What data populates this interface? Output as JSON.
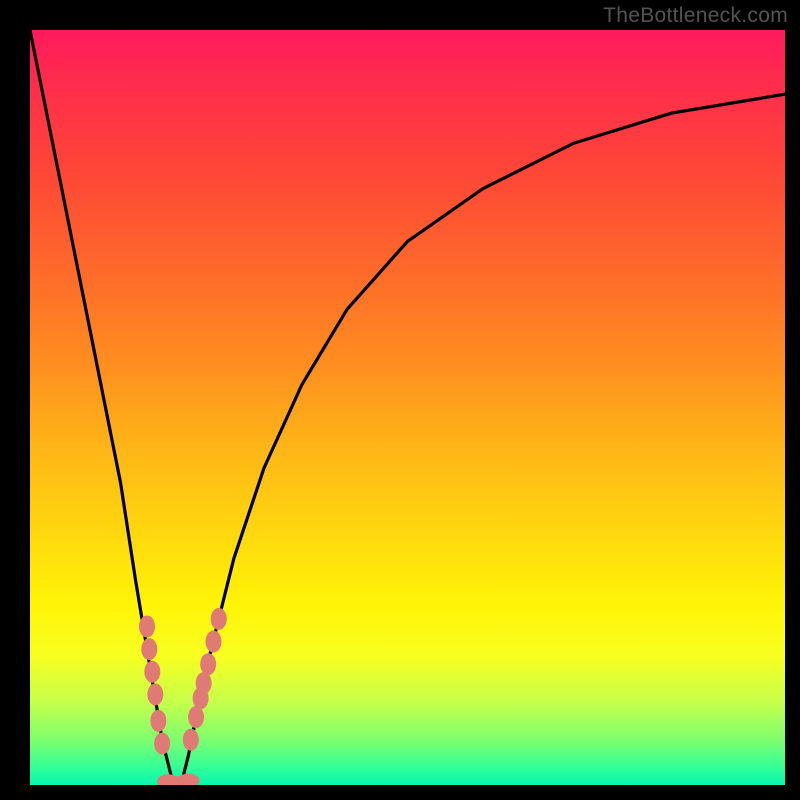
{
  "watermark": {
    "text": "TheBottleneck.com"
  },
  "colors": {
    "frame": "#000000",
    "curve_stroke": "#000000",
    "marker_fill": "#e07a74",
    "marker_stroke": "#c9635d",
    "gradient_stops": [
      "#ff1a5e",
      "#ff4438",
      "#ff8d20",
      "#ffd60e",
      "#fff407",
      "#c6ff4a",
      "#2bff9b"
    ]
  },
  "chart_data": {
    "type": "line",
    "title": "",
    "xlabel": "",
    "ylabel": "",
    "xlim": [
      0,
      100
    ],
    "ylim": [
      0,
      100
    ],
    "grid": false,
    "x": [
      0,
      3,
      6,
      9,
      12,
      14,
      16,
      17.5,
      19,
      20,
      21,
      22,
      24,
      27,
      31,
      36,
      42,
      50,
      60,
      72,
      85,
      100
    ],
    "values": [
      100,
      85,
      70,
      55,
      40,
      27,
      15,
      6,
      0,
      0,
      4,
      9,
      18,
      30,
      42,
      53,
      63,
      72,
      79,
      85,
      89,
      91.5
    ],
    "notch": {
      "x": 19.5,
      "y": 0
    },
    "markers_left_branch": [
      {
        "x": 15.5,
        "y": 21
      },
      {
        "x": 15.8,
        "y": 18
      },
      {
        "x": 16.2,
        "y": 15
      },
      {
        "x": 16.6,
        "y": 12
      },
      {
        "x": 17.0,
        "y": 8.5
      },
      {
        "x": 17.5,
        "y": 5.5
      }
    ],
    "markers_right_branch": [
      {
        "x": 21.3,
        "y": 6
      },
      {
        "x": 22.0,
        "y": 9
      },
      {
        "x": 22.6,
        "y": 11.5
      },
      {
        "x": 23.0,
        "y": 13.5
      },
      {
        "x": 23.6,
        "y": 16
      },
      {
        "x": 24.3,
        "y": 19
      },
      {
        "x": 25.0,
        "y": 22
      }
    ],
    "markers_bottom": [
      {
        "x": 18.3,
        "y": 0.5
      },
      {
        "x": 19.0,
        "y": 0.3
      },
      {
        "x": 19.7,
        "y": 0.2
      },
      {
        "x": 20.4,
        "y": 0.3
      },
      {
        "x": 21.0,
        "y": 0.6
      }
    ]
  }
}
